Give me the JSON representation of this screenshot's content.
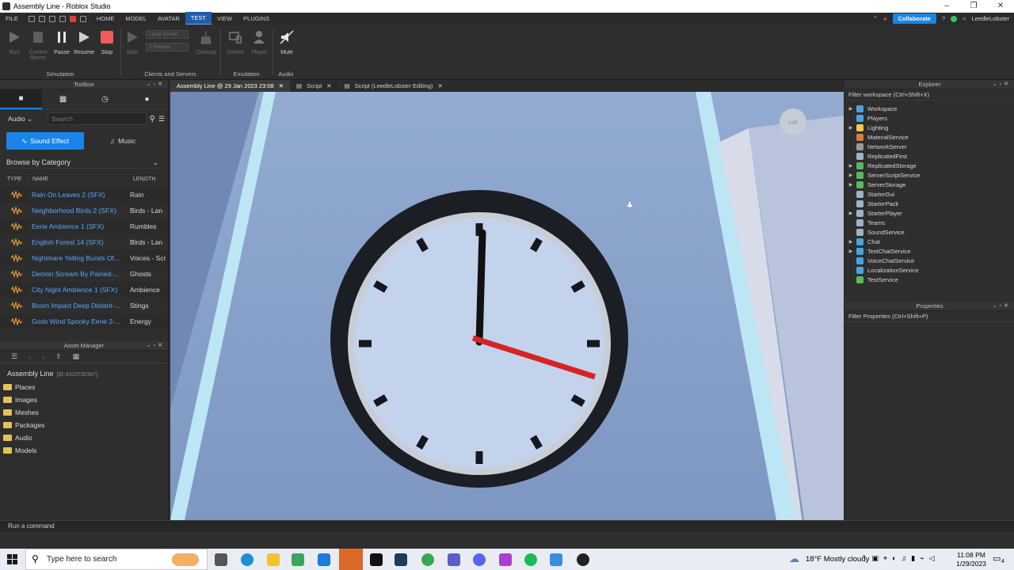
{
  "window": {
    "title": "Assembly Line - Roblox Studio"
  },
  "menu": {
    "items": [
      "FILE",
      "HOME",
      "MODEL",
      "AVATAR",
      "TEST",
      "VIEW",
      "PLUGINS"
    ],
    "active": "TEST",
    "collaborate": "Collaborate",
    "user": "LeedleLobster"
  },
  "ribbon": {
    "run": "Run",
    "current_server": "Current Server",
    "pause": "Pause",
    "resume": "Resume",
    "stop": "Stop",
    "start": "Start",
    "server_select": "Local Server",
    "players_select": "2 Players",
    "cleanup": "Cleanup",
    "device": "Device",
    "player": "Player",
    "mute": "Mute",
    "groups": {
      "simulation": "Simulation",
      "clients": "Clients and Servers",
      "emulation": "Emulation",
      "audio": "Audio"
    }
  },
  "toolbox": {
    "title": "Toolbox",
    "category": "Audio",
    "search_placeholder": "Search",
    "sound_effect": "Sound Effect",
    "music": "Music",
    "browse": "Browse by Category",
    "columns": {
      "type": "TYPE",
      "name": "NAME",
      "length": "LENGTH"
    },
    "sounds": [
      {
        "name": "Rain On Leaves 2 (SFX)",
        "length": "Rain"
      },
      {
        "name": "Neighborhood Birds 2 (SFX)",
        "length": "Birds - Lan"
      },
      {
        "name": "Eerie Ambience 1 (SFX)",
        "length": "Rumbles"
      },
      {
        "name": "English Forest 14 (SFX)",
        "length": "Birds - Lan"
      },
      {
        "name": "Nightmare Yelling Bursts Of...",
        "length": "Voices - Scr"
      },
      {
        "name": "Demon Scream By Pained-...",
        "length": "Ghosts"
      },
      {
        "name": "City Night Ambience 1 (SFX)",
        "length": "Ambience"
      },
      {
        "name": "Boom Impact Deep Distant-...",
        "length": "Stings"
      },
      {
        "name": "Gods Wind Spooky Eerie 2-...",
        "length": "Energy"
      }
    ]
  },
  "asset_manager": {
    "title": "Asset Manager",
    "place_name": "Assembly Line",
    "place_id": "[ID:4323730387]",
    "folders": [
      "Places",
      "Images",
      "Meshes",
      "Packages",
      "Audio",
      "Models"
    ]
  },
  "doc_tabs": [
    {
      "label": "Assembly Line @ 29 Jan 2023 23:08",
      "active": true
    },
    {
      "label": "Script",
      "active": false
    },
    {
      "label": "Script (LeedleLobster Editing)",
      "active": false
    }
  ],
  "viewport": {
    "part_label": "Left"
  },
  "explorer": {
    "title": "Explorer",
    "filter": "Filter workspace (Ctrl+Shift+X)",
    "items": [
      {
        "name": "Workspace",
        "expandable": true,
        "color": "#4aa3df"
      },
      {
        "name": "Players",
        "expandable": false,
        "color": "#4aa3df"
      },
      {
        "name": "Lighting",
        "expandable": true,
        "color": "#f2c94c"
      },
      {
        "name": "MaterialService",
        "expandable": false,
        "color": "#e07a3a"
      },
      {
        "name": "NetworkServer",
        "expandable": false,
        "color": "#9a9a9a"
      },
      {
        "name": "ReplicatedFirst",
        "expandable": false,
        "color": "#9fb3c8"
      },
      {
        "name": "ReplicatedStorage",
        "expandable": true,
        "color": "#5cb85c"
      },
      {
        "name": "ServerScriptService",
        "expandable": true,
        "color": "#5cb85c"
      },
      {
        "name": "ServerStorage",
        "expandable": true,
        "color": "#5cb85c"
      },
      {
        "name": "StarterGui",
        "expandable": false,
        "color": "#9fb3c8"
      },
      {
        "name": "StarterPack",
        "expandable": false,
        "color": "#9fb3c8"
      },
      {
        "name": "StarterPlayer",
        "expandable": true,
        "color": "#9fb3c8"
      },
      {
        "name": "Teams",
        "expandable": false,
        "color": "#9fb3c8"
      },
      {
        "name": "SoundService",
        "expandable": false,
        "color": "#9fb3c8"
      },
      {
        "name": "Chat",
        "expandable": true,
        "color": "#4aa3df"
      },
      {
        "name": "TextChatService",
        "expandable": true,
        "color": "#4aa3df"
      },
      {
        "name": "VoiceChatService",
        "expandable": false,
        "color": "#4aa3df"
      },
      {
        "name": "LocalizationService",
        "expandable": false,
        "color": "#4aa3df"
      },
      {
        "name": "TestService",
        "expandable": false,
        "color": "#5cb85c"
      }
    ]
  },
  "properties": {
    "title": "Properties",
    "filter": "Filter Properties (Ctrl+Shift+P)"
  },
  "command_bar": {
    "placeholder": "Run a command"
  },
  "taskbar": {
    "search_placeholder": "Type here to search",
    "weather": "18°F  Mostly cloudy",
    "time": "11:08 PM",
    "date": "1/29/2023",
    "notifications": "4"
  }
}
